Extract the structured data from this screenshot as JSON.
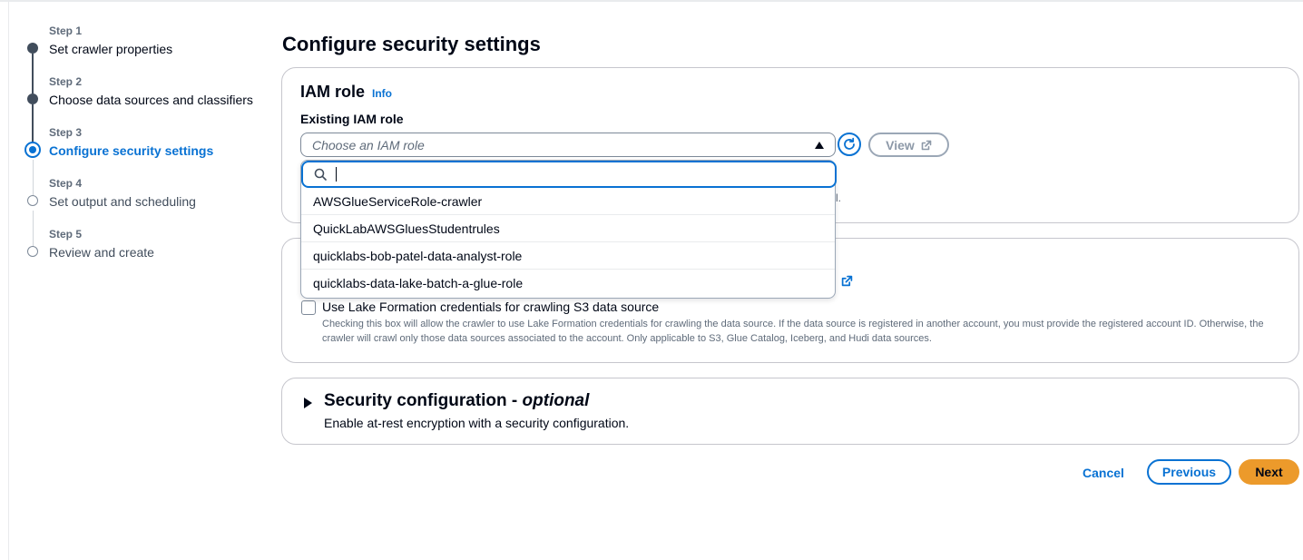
{
  "steps": [
    {
      "num": "Step 1",
      "title": "Set crawler properties",
      "state": "done"
    },
    {
      "num": "Step 2",
      "title": "Choose data sources and classifiers",
      "state": "done"
    },
    {
      "num": "Step 3",
      "title": "Configure security settings",
      "state": "current"
    },
    {
      "num": "Step 4",
      "title": "Set output and scheduling",
      "state": "pending"
    },
    {
      "num": "Step 5",
      "title": "Review and create",
      "state": "pending"
    }
  ],
  "page": {
    "title": "Configure security settings"
  },
  "iam": {
    "title": "IAM role",
    "info": "Info",
    "field_label": "Existing IAM role",
    "select_placeholder": "Choose an IAM role",
    "view_label": "View",
    "hidden_tail": "l."
  },
  "dropdown": {
    "search_value": "",
    "options": [
      "AWSGlueServiceRole-crawler",
      "QuickLabAWSGluesStudentrules",
      "quicklabs-bob-patel-data-analyst-role",
      "quicklabs-data-lake-batch-a-glue-role"
    ]
  },
  "lake_formation": {
    "checkbox_label": "Use Lake Formation credentials for crawling S3 data source",
    "description": "Checking this box will allow the crawler to use Lake Formation credentials for crawling the data source. If the data source is registered in another account, you must provide the registered account ID. Otherwise, the crawler will crawl only those data sources associated to the account. Only applicable to S3, Glue Catalog, Iceberg, and Hudi data sources.",
    "checked": false
  },
  "security_config": {
    "title": "Security configuration - ",
    "title_optional": "optional",
    "description": "Enable at-rest encryption with a security configuration."
  },
  "footer": {
    "cancel": "Cancel",
    "previous": "Previous",
    "next": "Next"
  },
  "colors": {
    "accent": "#0972d3",
    "primary_button": "#ec9a2b"
  }
}
